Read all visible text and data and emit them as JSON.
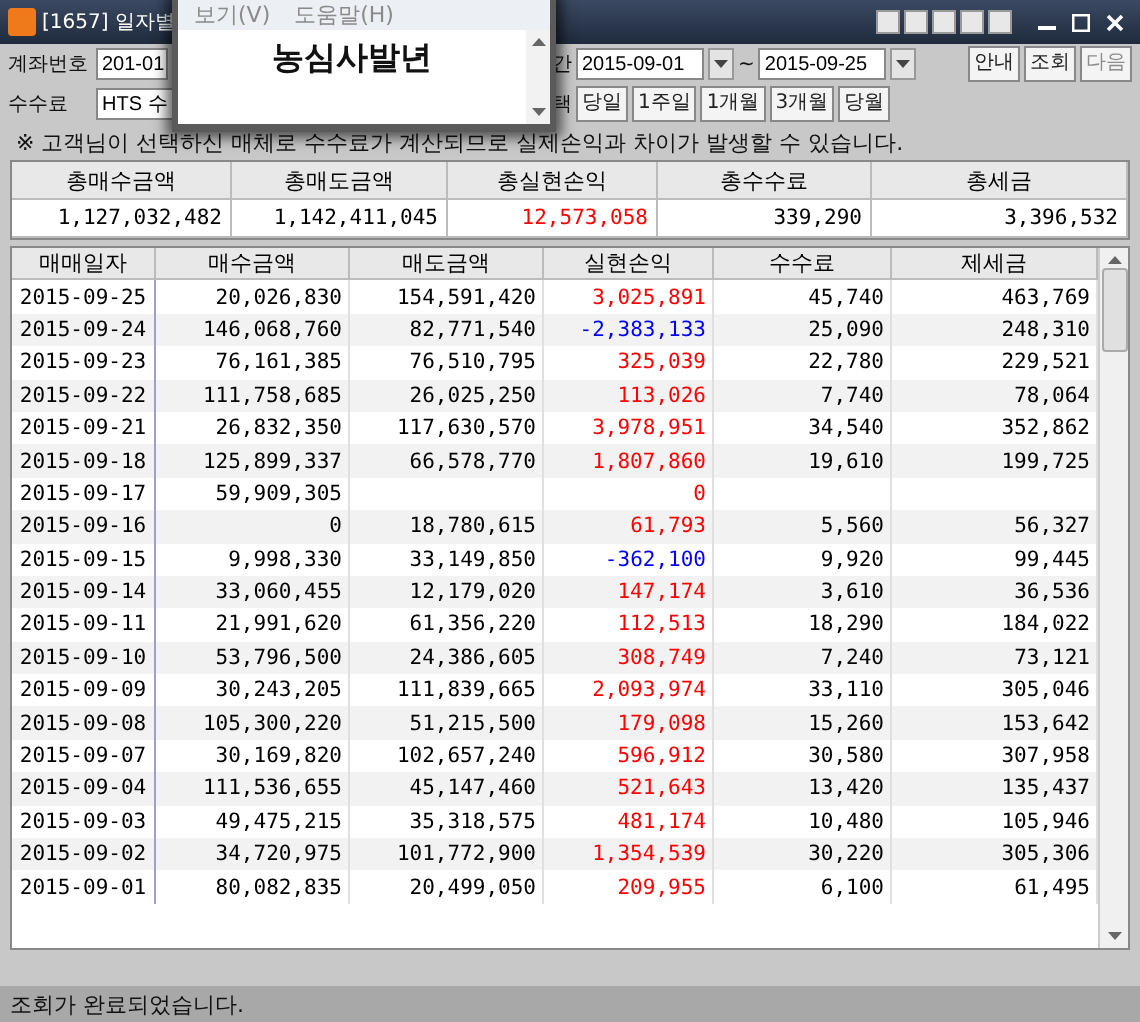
{
  "window": {
    "title": "[1657] 일자별"
  },
  "popup": {
    "menu": [
      "보기(V)",
      "도움말(H)"
    ],
    "text": "농심사발년"
  },
  "form": {
    "account_label": "계좌번호",
    "account_value": "201-01",
    "period_label": "간",
    "date_from": "2015-09-01",
    "separator": "~",
    "date_to": "2015-09-25",
    "fee_label": "수수료",
    "fee_value": "HTS 수",
    "select_label": "택",
    "quick_buttons": [
      "당일",
      "1주일",
      "1개월",
      "3개월",
      "당월"
    ],
    "actions": [
      {
        "label": "안내",
        "disabled": false
      },
      {
        "label": "조회",
        "disabled": false
      },
      {
        "label": "다음",
        "disabled": true
      }
    ],
    "notice": "※ 고객님이 선택하신 매체로 수수료가 계산되므로 실제손익과 차이가 발생할 수 있습니다."
  },
  "summary": {
    "columns": [
      "총매수금액",
      "총매도금액",
      "총실현손익",
      "총수수료",
      "총세금"
    ],
    "values": [
      "1,127,032,482",
      "1,142,411,045",
      "12,573,058",
      "339,290",
      "3,396,532"
    ]
  },
  "table": {
    "columns": [
      "매매일자",
      "매수금액",
      "매도금액",
      "실현손익",
      "수수료",
      "제세금"
    ],
    "rows": [
      {
        "cells": [
          "2015-09-25",
          "20,026,830",
          "154,591,420",
          "3,025,891",
          "45,740",
          "463,769"
        ],
        "color": "#ff0000"
      },
      {
        "cells": [
          "2015-09-24",
          "146,068,760",
          "82,771,540",
          "-2,383,133",
          "25,090",
          "248,310"
        ],
        "color": "#0000ff"
      },
      {
        "cells": [
          "2015-09-23",
          "76,161,385",
          "76,510,795",
          "325,039",
          "22,780",
          "229,521"
        ],
        "color": "#ff0000"
      },
      {
        "cells": [
          "2015-09-22",
          "111,758,685",
          "26,025,250",
          "113,026",
          "7,740",
          "78,064"
        ],
        "color": "#ff0000"
      },
      {
        "cells": [
          "2015-09-21",
          "26,832,350",
          "117,630,570",
          "3,978,951",
          "34,540",
          "352,862"
        ],
        "color": "#ff0000"
      },
      {
        "cells": [
          "2015-09-18",
          "125,899,337",
          "66,578,770",
          "1,807,860",
          "19,610",
          "199,725"
        ],
        "color": "#ff0000"
      },
      {
        "cells": [
          "2015-09-17",
          "59,909,305",
          null,
          "0",
          null,
          null
        ],
        "color": "#ff0000"
      },
      {
        "cells": [
          "2015-09-16",
          "0",
          "18,780,615",
          "61,793",
          "5,560",
          "56,327"
        ],
        "color": "#ff0000"
      },
      {
        "cells": [
          "2015-09-15",
          "9,998,330",
          "33,149,850",
          "-362,100",
          "9,920",
          "99,445"
        ],
        "color": "#0000ff"
      },
      {
        "cells": [
          "2015-09-14",
          "33,060,455",
          "12,179,020",
          "147,174",
          "3,610",
          "36,536"
        ],
        "color": "#ff0000"
      },
      {
        "cells": [
          "2015-09-11",
          "21,991,620",
          "61,356,220",
          "112,513",
          "18,290",
          "184,022"
        ],
        "color": "#ff0000"
      },
      {
        "cells": [
          "2015-09-10",
          "53,796,500",
          "24,386,605",
          "308,749",
          "7,240",
          "73,121"
        ],
        "color": "#ff0000"
      },
      {
        "cells": [
          "2015-09-09",
          "30,243,205",
          "111,839,665",
          "2,093,974",
          "33,110",
          "305,046"
        ],
        "color": "#ff0000"
      },
      {
        "cells": [
          "2015-09-08",
          "105,300,220",
          "51,215,500",
          "179,098",
          "15,260",
          "153,642"
        ],
        "color": "#ff0000"
      },
      {
        "cells": [
          "2015-09-07",
          "30,169,820",
          "102,657,240",
          "596,912",
          "30,580",
          "307,958"
        ],
        "color": "#ff0000"
      },
      {
        "cells": [
          "2015-09-04",
          "111,536,655",
          "45,147,460",
          "521,643",
          "13,420",
          "135,437"
        ],
        "color": "#ff0000"
      },
      {
        "cells": [
          "2015-09-03",
          "49,475,215",
          "35,318,575",
          "481,174",
          "10,480",
          "105,946"
        ],
        "color": "#ff0000"
      },
      {
        "cells": [
          "2015-09-02",
          "34,720,975",
          "101,772,900",
          "1,354,539",
          "30,220",
          "305,306"
        ],
        "color": "#ff0000"
      },
      {
        "cells": [
          "2015-09-01",
          "80,082,835",
          "20,499,050",
          "209,955",
          "6,100",
          "61,495"
        ],
        "color": "#ff0000"
      }
    ]
  },
  "status_bar": {
    "text": "조회가 완료되었습니다."
  }
}
